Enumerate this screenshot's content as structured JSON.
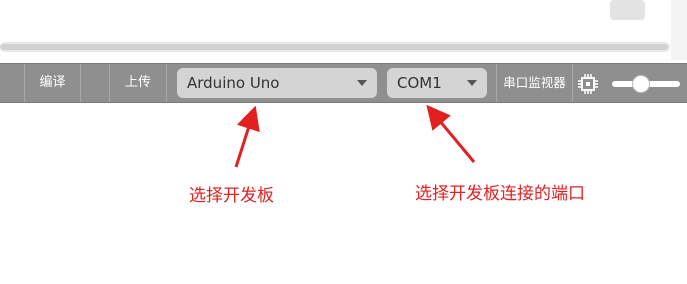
{
  "toolbar": {
    "compile_label": "编译",
    "upload_label": "上传",
    "board_select_value": "Arduino Uno",
    "port_select_value": "COM1",
    "serial_monitor_label": "串口监视器",
    "zoom_slider_value": 0.4
  },
  "annotations": {
    "board_note": "选择开发板",
    "port_note": "选择开发板连接的端口"
  },
  "colors": {
    "toolbar_bg": "#8f8f8f",
    "select_bg": "#d4d4d4",
    "annotation_red": "#e32020"
  },
  "icons": [
    "chip-icon",
    "chevron-down-icon"
  ]
}
